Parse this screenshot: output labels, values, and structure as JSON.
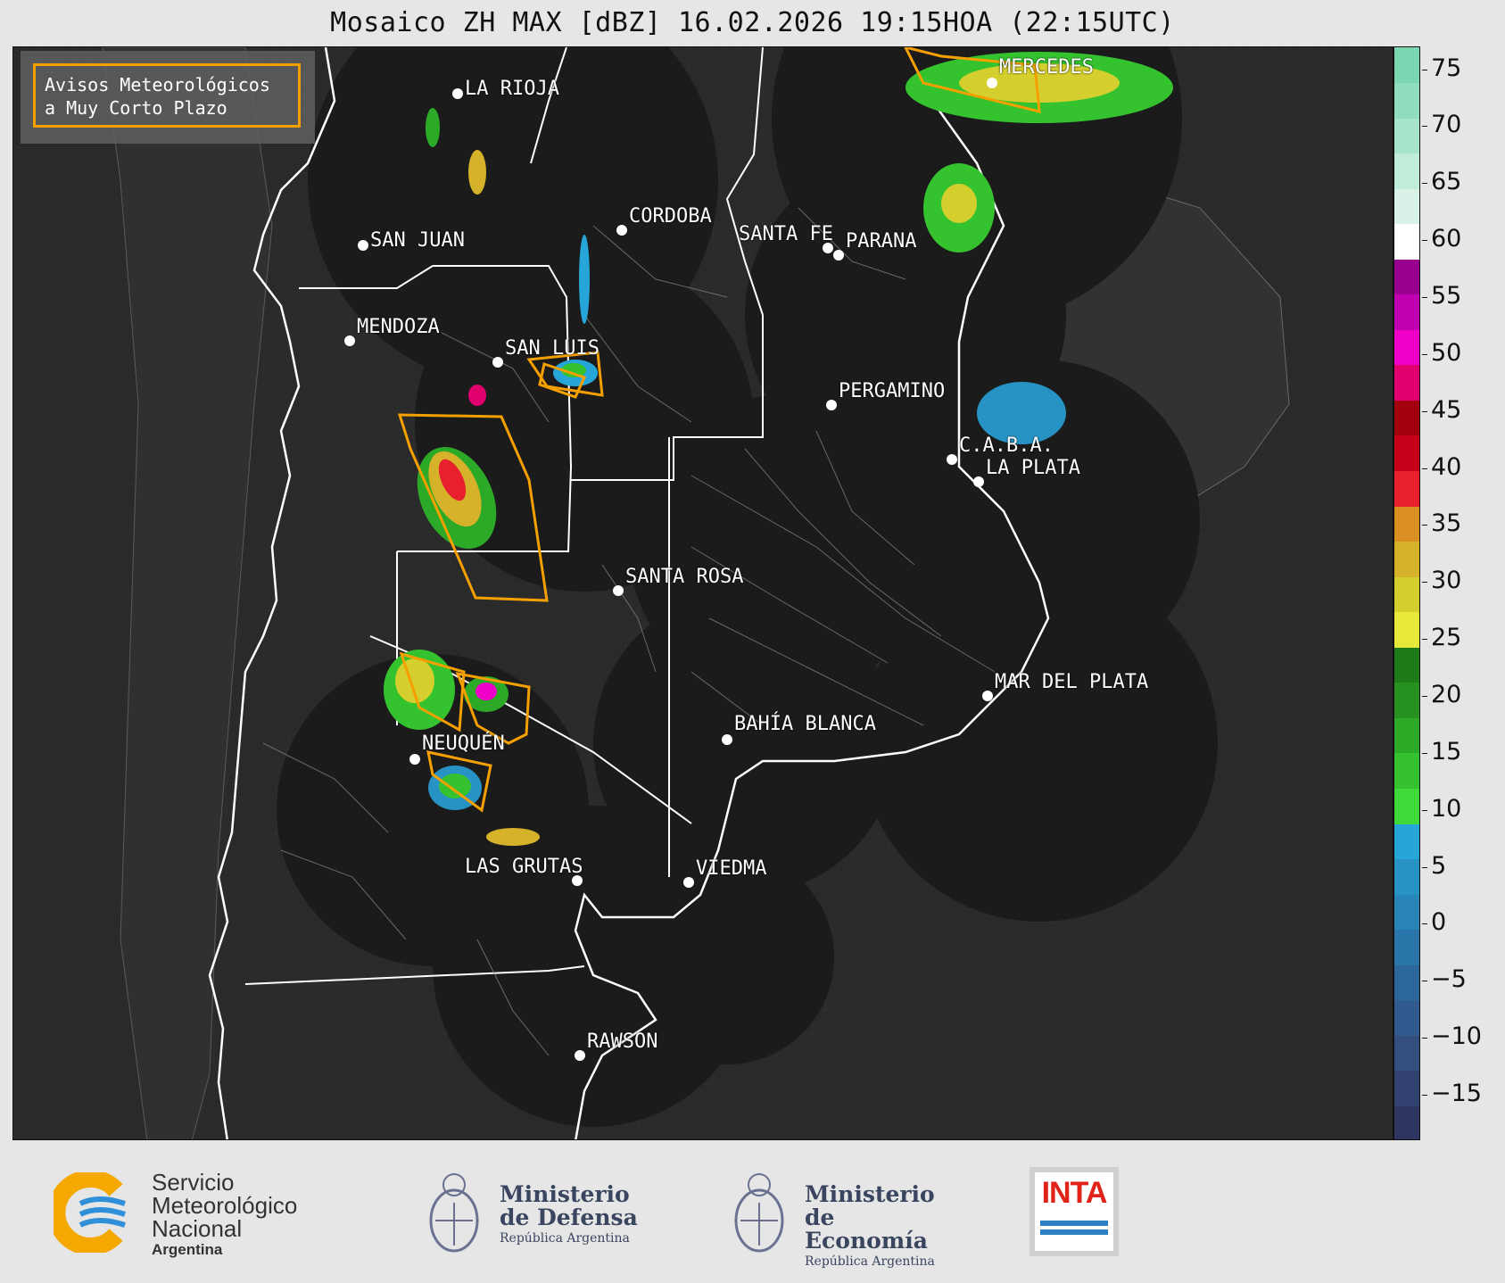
{
  "title": "Mosaico ZH MAX [dBZ] 16.02.2026 19:15HOA (22:15UTC)",
  "legend": {
    "line1": "Avisos Meteorológicos",
    "line2": "a Muy Corto Plazo",
    "swatch_color": "#f5a000"
  },
  "cities": [
    {
      "name": "LA RIOJA"
    },
    {
      "name": "SAN JUAN"
    },
    {
      "name": "CORDOBA"
    },
    {
      "name": "SANTA FE"
    },
    {
      "name": "PARANA"
    },
    {
      "name": "MERCEDES"
    },
    {
      "name": "MENDOZA"
    },
    {
      "name": "SAN LUIS"
    },
    {
      "name": "PERGAMINO"
    },
    {
      "name": "C.A.B.A."
    },
    {
      "name": "LA PLATA"
    },
    {
      "name": "SANTA ROSA"
    },
    {
      "name": "NEUQUÉN"
    },
    {
      "name": "BAHÍA BLANCA"
    },
    {
      "name": "MAR DEL PLATA"
    },
    {
      "name": "LAS GRUTAS"
    },
    {
      "name": "VIEDMA"
    },
    {
      "name": "RAWSON"
    }
  ],
  "colorbar": {
    "unit": "dBZ",
    "ticks": [
      "75",
      "70",
      "65",
      "60",
      "55",
      "50",
      "45",
      "40",
      "35",
      "30",
      "25",
      "20",
      "15",
      "10",
      "5",
      "0",
      "−5",
      "−10",
      "−15"
    ],
    "range": [
      -19,
      77
    ],
    "colors": [
      "#2f3561",
      "#324270",
      "#334f80",
      "#315a8e",
      "#2c679c",
      "#2a76aa",
      "#2985b7",
      "#2793c4",
      "#26a6d8",
      "#3fd93b",
      "#35c22f",
      "#2ca927",
      "#26911f",
      "#1f7a1a",
      "#e8e83a",
      "#d4cf2e",
      "#d6b12a",
      "#db8e22",
      "#e8202e",
      "#c7001a",
      "#a3000f",
      "#e0006e",
      "#ef00c8",
      "#c000b0",
      "#9a0090",
      "#ffffff",
      "#d8f2e8",
      "#c0ecda",
      "#a6e4cc",
      "#8fdcbe",
      "#7bd6b2"
    ]
  },
  "footer": {
    "smn": {
      "line1": "Servicio",
      "line2": "Meteorológico",
      "line3": "Nacional",
      "line4": "Argentina"
    },
    "defensa": {
      "line1": "Ministerio",
      "line2": "de Defensa",
      "line3": "República Argentina"
    },
    "economia": {
      "line1": "Ministerio",
      "line2": "de Economía",
      "line3": "República Argentina"
    },
    "inta": {
      "label": "INTA"
    }
  }
}
